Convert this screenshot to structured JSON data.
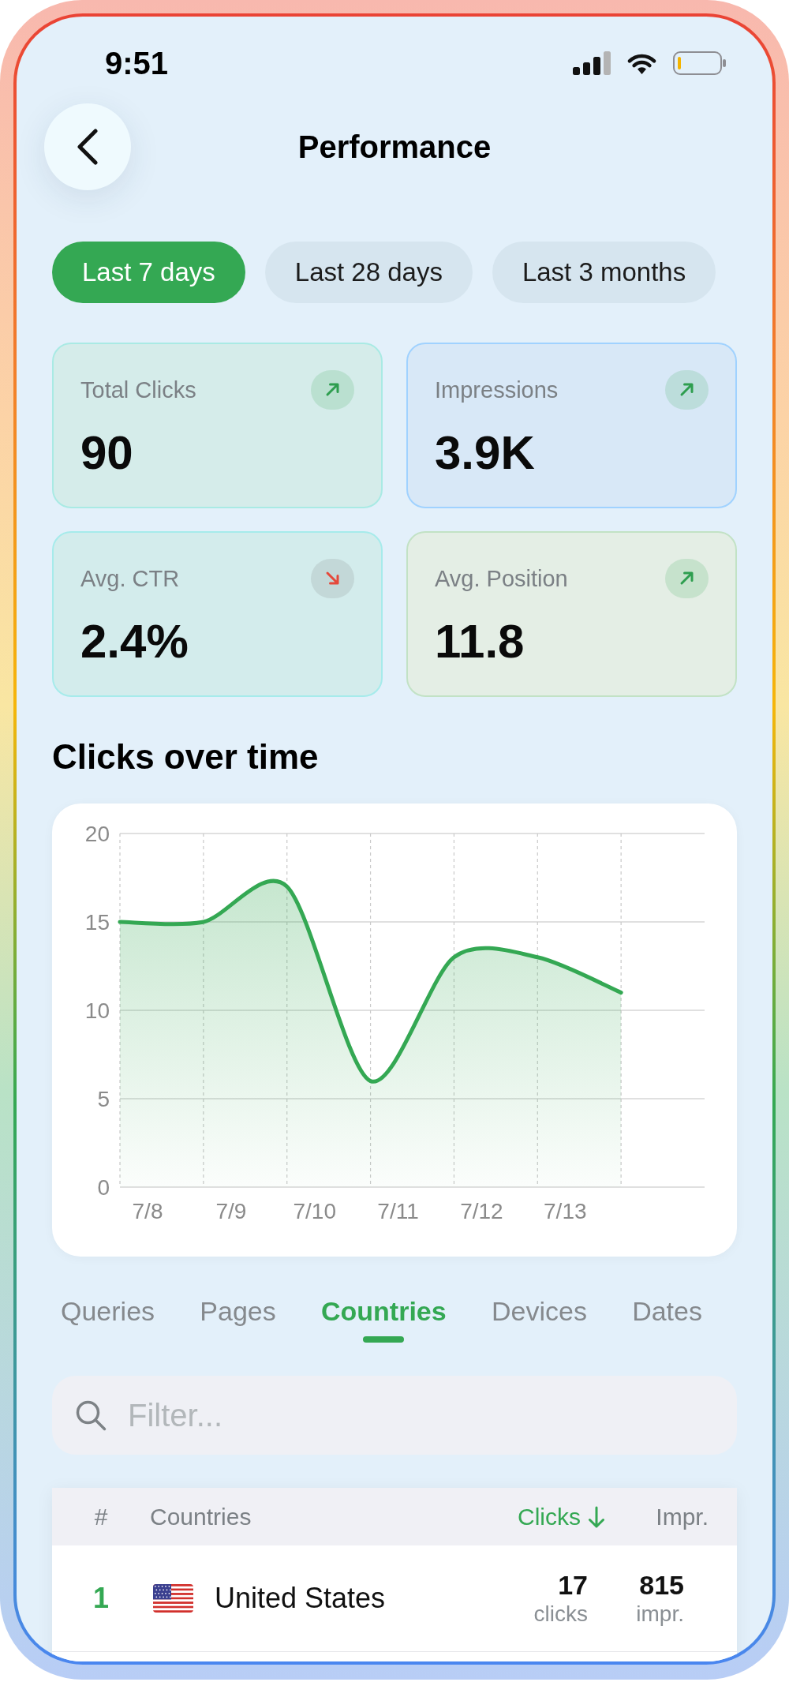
{
  "status_bar": {
    "time": "9:51"
  },
  "header": {
    "title": "Performance"
  },
  "date_ranges": [
    {
      "label": "Last 7 days",
      "selected": true
    },
    {
      "label": "Last 28 days",
      "selected": false
    },
    {
      "label": "Last 3 months",
      "selected": false
    }
  ],
  "metrics": [
    {
      "label": "Total Clicks",
      "value": "90",
      "rising": true,
      "color": "#d5ecea"
    },
    {
      "label": "Impressions",
      "value": "3.9K",
      "rising": true,
      "color": "#d8e8f7"
    },
    {
      "label": "Avg. CTR",
      "value": "2.4%",
      "rising": false,
      "color": "#d3ecec"
    },
    {
      "label": "Avg. Position",
      "value": "11.8",
      "rising": true,
      "color": "#e4eee5"
    }
  ],
  "chart": {
    "title": "Clicks over time",
    "chart_data": {
      "type": "area",
      "categories": [
        "7/8",
        "7/9",
        "7/10",
        "7/11",
        "7/12",
        "7/13",
        null
      ],
      "ylim": [
        0,
        20
      ],
      "yticks": [
        0,
        5,
        10,
        15,
        20
      ],
      "grid": true,
      "series": [
        {
          "color": "#34a853",
          "values": [
            15,
            15,
            17,
            6,
            13,
            13,
            11
          ]
        }
      ]
    }
  },
  "data_tabs": [
    {
      "label": "Queries",
      "selected": false
    },
    {
      "label": "Pages",
      "selected": false
    },
    {
      "label": "Countries",
      "selected": true
    },
    {
      "label": "Devices",
      "selected": false
    },
    {
      "label": "Dates",
      "selected": false
    }
  ],
  "filter": {
    "placeholder": "Filter..."
  },
  "table": {
    "columns": [
      {
        "label": "#",
        "sorted": false
      },
      {
        "label": "Countries",
        "sorted": false
      },
      {
        "label": "Clicks",
        "sorted": true
      },
      {
        "label": "Impr.",
        "sorted": false
      }
    ],
    "rows": [
      {
        "rank": "1",
        "country": "United States",
        "clicks": "17",
        "clicks_unit": "clicks",
        "impressions": "815",
        "impressions_unit": "impr."
      }
    ]
  }
}
